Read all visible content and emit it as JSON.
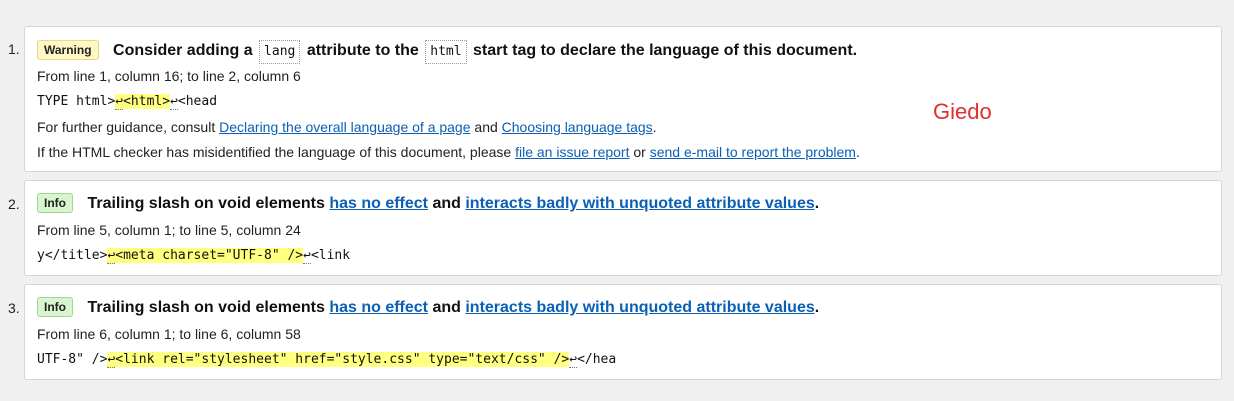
{
  "messages": [
    {
      "number": "1.",
      "badge": "Warning",
      "text_a": "Consider adding a",
      "code_a": "lang",
      "text_b": "attribute to the",
      "code_b": "html",
      "text_c": "start tag to declare the language of this document.",
      "location": "From line 1, column 16; to line 2, column 6",
      "extract_pre": "TYPE html>",
      "extract_ret1": "↩",
      "extract_hl": "<html>",
      "extract_ret2": "↩",
      "extract_post": "<head",
      "guidance_prefix": "For further guidance, consult",
      "guidance_link1": "Declaring the overall language of a page",
      "guidance_and": "and",
      "guidance_link2": "Choosing language tags",
      "guidance_end": ".",
      "report_prefix": "If the HTML checker has misidentified the language of this document, please",
      "report_link1": "file an issue report",
      "report_or": "or",
      "report_link2": "send e-mail to report the problem",
      "report_end": "."
    },
    {
      "number": "2.",
      "badge": "Info",
      "text_a": "Trailing slash on void elements",
      "link_a": "has no effect",
      "text_b": "and",
      "link_b": "interacts badly with unquoted attribute values",
      "text_c": ".",
      "location": "From line 5, column 1; to line 5, column 24",
      "extract_pre": "y</title>",
      "extract_ret1": "↩",
      "extract_hl": "<meta charset=\"UTF-8\" />",
      "extract_ret2": "↩",
      "extract_post": "<link"
    },
    {
      "number": "3.",
      "badge": "Info",
      "text_a": "Trailing slash on void elements",
      "link_a": "has no effect",
      "text_b": "and",
      "link_b": "interacts badly with unquoted attribute values",
      "text_c": ".",
      "location": "From line 6, column 1; to line 6, column 58",
      "extract_pre": "UTF-8\" />",
      "extract_ret1": "↩",
      "extract_hl": "<link rel=\"stylesheet\" href=\"style.css\" type=\"text/css\" />",
      "extract_ret2": "↩",
      "extract_post": "</hea"
    }
  ],
  "watermark": "Giedo",
  "colors": {
    "warning_badge": "#fff8c4",
    "info_badge": "#d8f5d0",
    "link": "#0b5fb4",
    "highlight": "#ffff80",
    "watermark": "#e03030"
  }
}
